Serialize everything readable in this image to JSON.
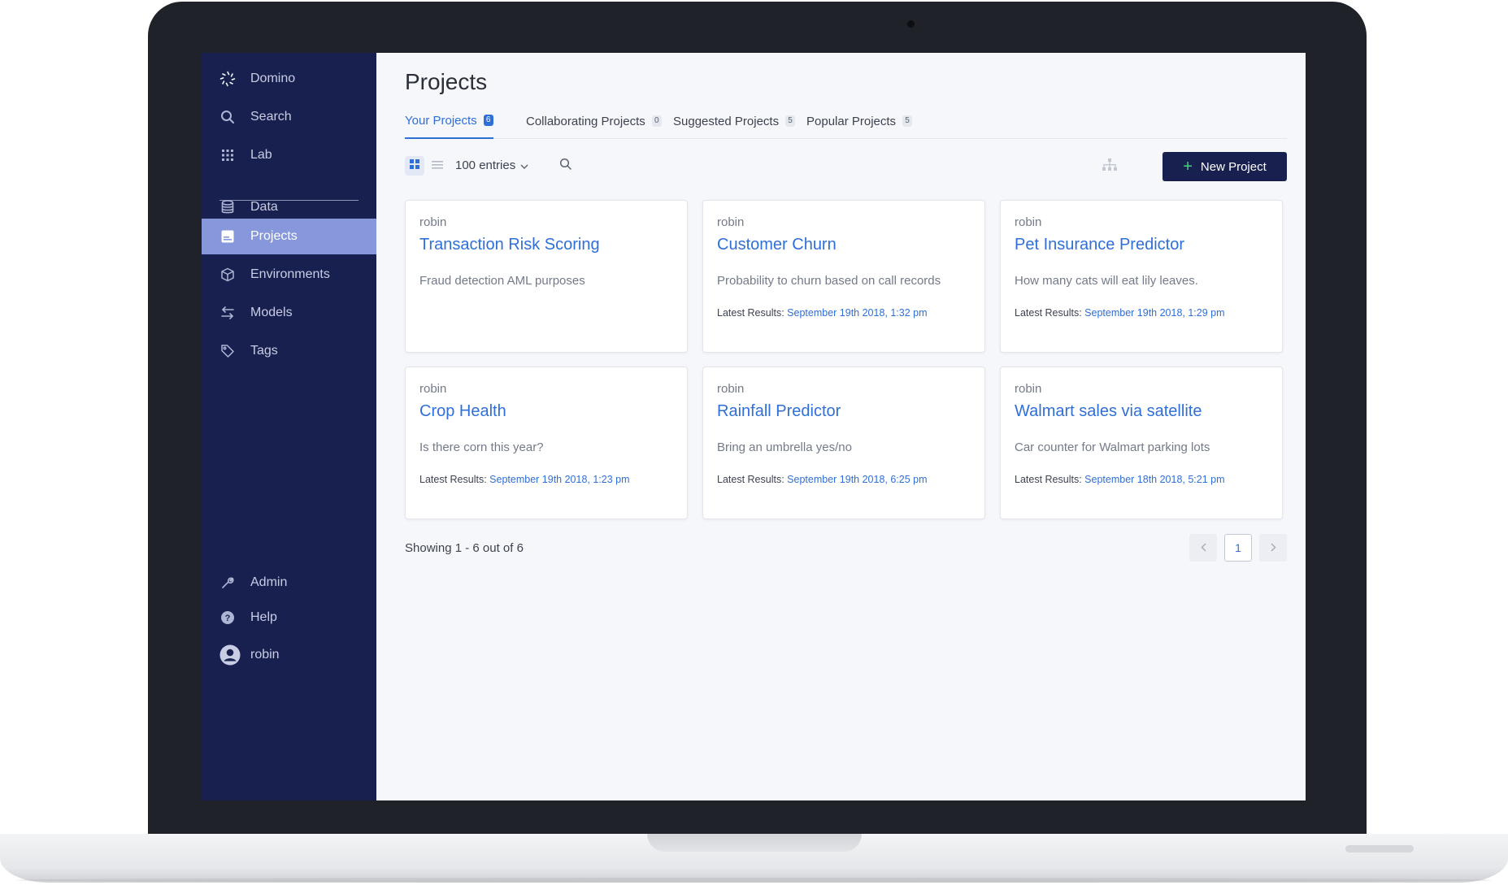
{
  "app": {
    "name": "Domino"
  },
  "sidebar": {
    "items": [
      {
        "label": "Search",
        "icon": "search-icon"
      },
      {
        "label": "Lab",
        "icon": "grid-icon"
      },
      {
        "label": "Data",
        "icon": "database-icon"
      },
      {
        "label": "Projects",
        "icon": "projects-icon",
        "active": true
      },
      {
        "label": "Environments",
        "icon": "cube-icon"
      },
      {
        "label": "Models",
        "icon": "arrows-icon"
      },
      {
        "label": "Tags",
        "icon": "tag-icon"
      }
    ],
    "bottom": [
      {
        "label": "Admin",
        "icon": "wrench-icon"
      },
      {
        "label": "Help",
        "icon": "help-icon"
      },
      {
        "label": "robin",
        "icon": "user-avatar-icon"
      }
    ]
  },
  "page": {
    "title": "Projects"
  },
  "tabs": [
    {
      "label": "Your Projects",
      "count": "6",
      "active": true
    },
    {
      "label": "Collaborating Projects",
      "count": "0"
    },
    {
      "label": "Suggested Projects",
      "count": "5"
    },
    {
      "label": "Popular Projects",
      "count": "5"
    }
  ],
  "toolbar": {
    "entries": "100 entries",
    "new_project": "New Project"
  },
  "projects": [
    {
      "owner": "robin",
      "title": "Transaction Risk Scoring",
      "description": "Fraud detection AML purposes",
      "latest_label": "",
      "latest_date": ""
    },
    {
      "owner": "robin",
      "title": "Customer Churn",
      "description": "Probability to churn based on call records",
      "latest_label": "Latest Results:",
      "latest_date": "September 19th 2018, 1:32 pm"
    },
    {
      "owner": "robin",
      "title": "Pet Insurance Predictor",
      "description": "How many cats will eat lily leaves.",
      "latest_label": "Latest Results:",
      "latest_date": "September 19th 2018, 1:29 pm"
    },
    {
      "owner": "robin",
      "title": "Crop Health",
      "description": "Is there corn this year?",
      "latest_label": "Latest Results:",
      "latest_date": "September 19th 2018, 1:23 pm"
    },
    {
      "owner": "robin",
      "title": "Rainfall Predictor",
      "description": "Bring an umbrella yes/no",
      "latest_label": "Latest Results:",
      "latest_date": "September 19th 2018, 6:25 pm"
    },
    {
      "owner": "robin",
      "title": "Walmart sales via satellite",
      "description": "Car counter for Walmart parking lots",
      "latest_label": "Latest Results:",
      "latest_date": "September 18th 2018, 5:21 pm"
    }
  ],
  "footer": {
    "showing": "Showing 1 - 6 out of 6",
    "page": "1"
  },
  "colors": {
    "sidebar": "#18204f",
    "active_nav": "#8797db",
    "accent": "#2f6fd8",
    "add_icon": "#47d27a"
  }
}
